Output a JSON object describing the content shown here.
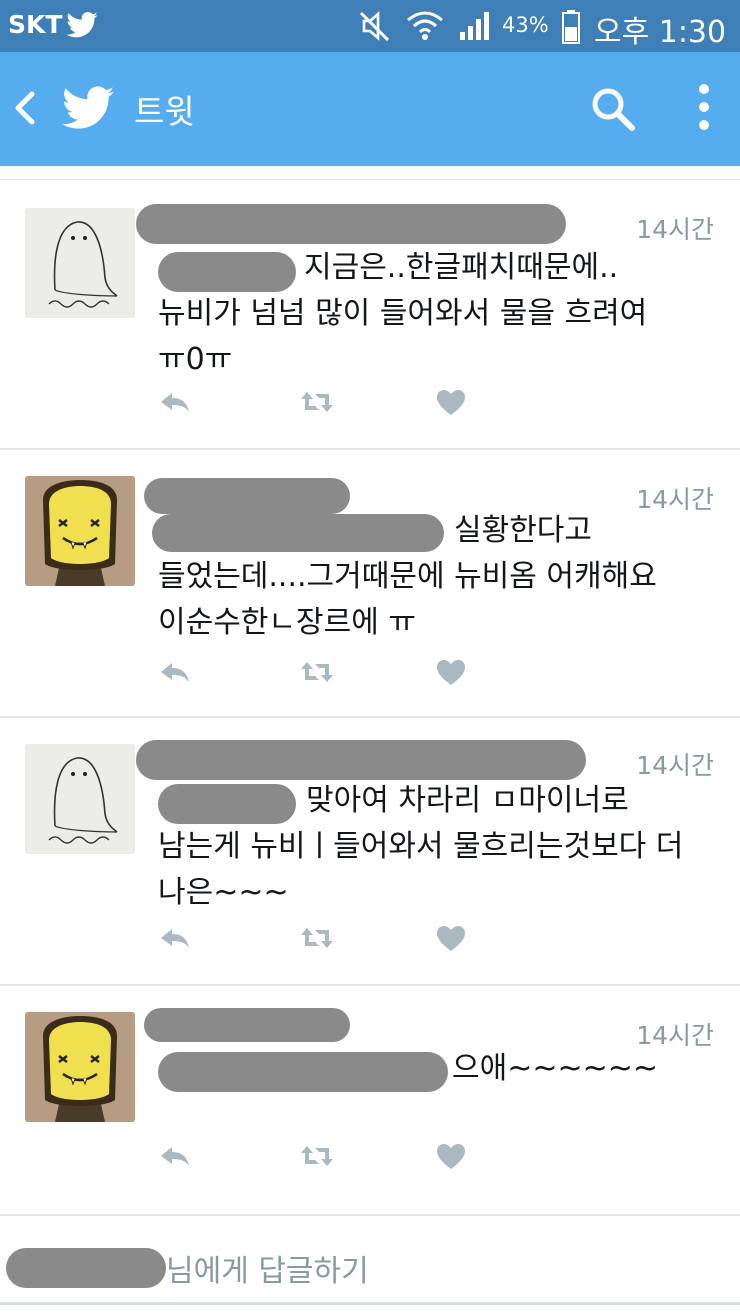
{
  "status_bar": {
    "carrier": "SKT",
    "battery_pct": "43%",
    "time": "오후 1:30"
  },
  "app_bar": {
    "title": "트윗"
  },
  "tweets": [
    {
      "time": "14시간",
      "lines": [
        "지금은..한글패치때문에..",
        "뉴비가 넘넘 많이 들어와서 물을 흐려여",
        "ㅠ0ㅠ"
      ],
      "avatar": "ghost-sketch-avatar"
    },
    {
      "time": "14시간",
      "lines": [
        "실황한다고",
        "들었는데....그거때문에 뉴비옴 어캐해요",
        "이순수한ㄴ장르에 ㅠ"
      ],
      "avatar": "yellow-character-avatar"
    },
    {
      "time": "14시간",
      "lines": [
        "맞아여 차라리 ㅁ마이너로",
        "남는게 뉴비ㅣ들어와서 물흐리는것보다 더",
        "나은~~~"
      ],
      "avatar": "ghost-sketch-avatar"
    },
    {
      "time": "14시간",
      "lines": [
        "으애~~~~~~"
      ],
      "avatar": "yellow-character-avatar"
    }
  ],
  "reply": {
    "placeholder": "님에게 답글하기"
  },
  "colors": {
    "status_bar": "#3f7fb8",
    "app_bar": "#55acee",
    "action_icon": "#aab8c2",
    "timestamp": "#8899a6"
  }
}
